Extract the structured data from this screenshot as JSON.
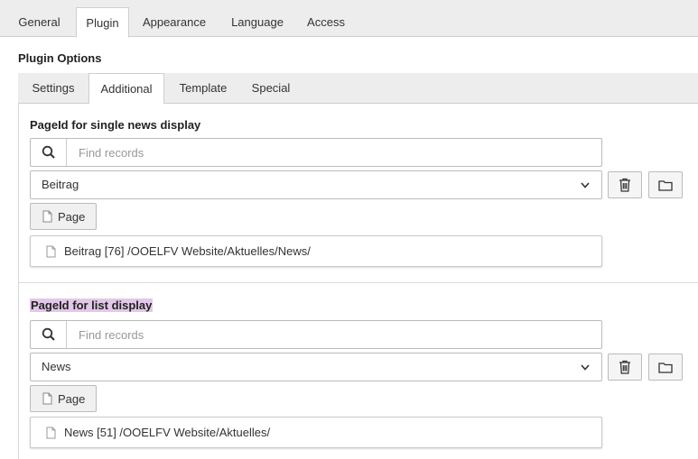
{
  "top_tabs": [
    "General",
    "Plugin",
    "Appearance",
    "Language",
    "Access"
  ],
  "section_title": "Plugin Options",
  "sub_tabs": [
    "Settings",
    "Additional",
    "Template",
    "Special"
  ],
  "fields": [
    {
      "label": "PageId for single news display",
      "search_placeholder": "Find records",
      "selected": "Beitrag",
      "page_button": "Page",
      "record": "Beitrag [76] /OOELFV Website/Aktuelles/News/"
    },
    {
      "label": "PageId for list display",
      "search_placeholder": "Find records",
      "selected": "News",
      "page_button": "Page",
      "record": "News [51] /OOELFV Website/Aktuelles/"
    }
  ],
  "colors": {
    "highlight": "#e3c7e8",
    "tab_bar": "#ededed"
  }
}
